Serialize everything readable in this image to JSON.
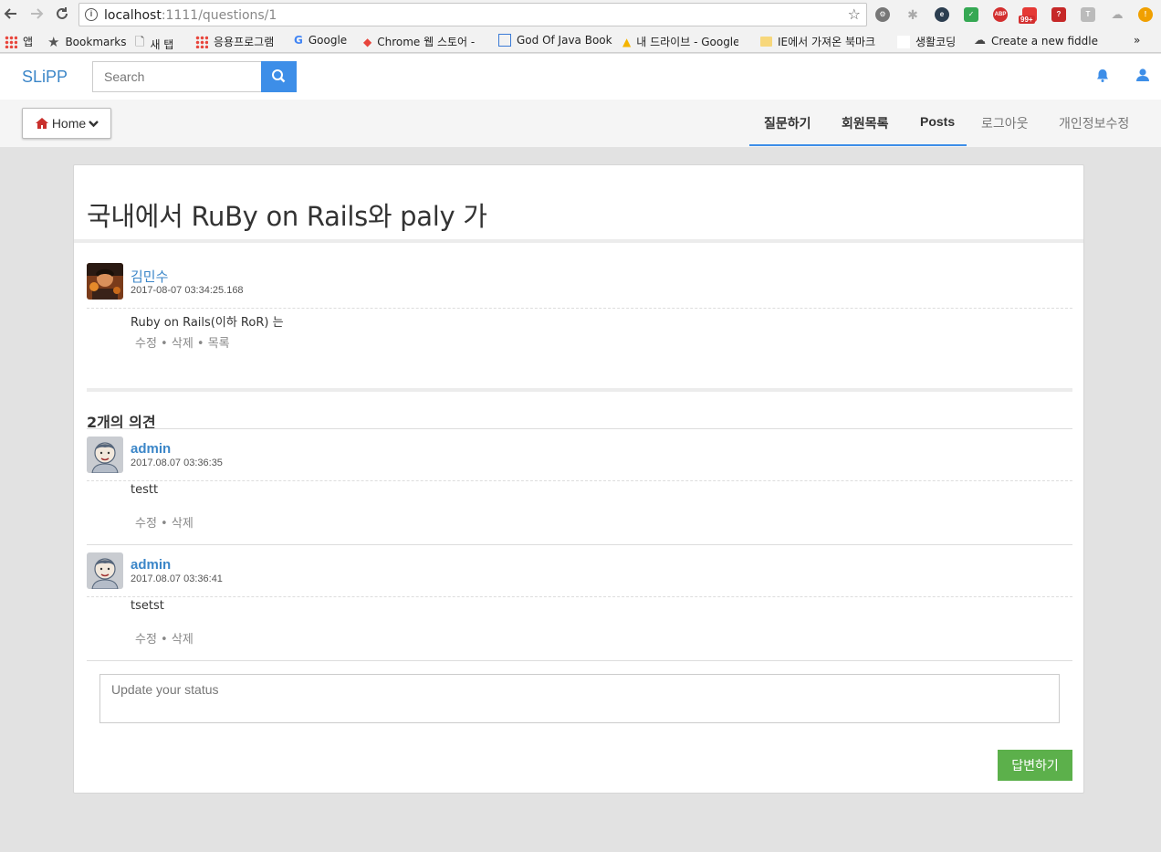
{
  "browser": {
    "url_host": "localhost",
    "url_path": ":1111/questions/1",
    "bookmarks": [
      "앱",
      "Bookmarks",
      "새 탭",
      "응용프로그램",
      "Google",
      "Chrome 웹 스토어 -",
      "God Of Java Book",
      "내 드라이브 - Google",
      "IE에서 가져온 북마크",
      "생활코딩",
      "Create a new fiddle"
    ],
    "more": "»",
    "badge": "99+",
    "abp": "ABP"
  },
  "navbar": {
    "brand": "SLiPP",
    "search_placeholder": "Search"
  },
  "subnav": {
    "home_label": "Home",
    "tabs": [
      "질문하기",
      "회원목록",
      "Posts",
      "로그아웃",
      "개인정보수정"
    ]
  },
  "question": {
    "title": "국내에서 RuBy on Rails와 paly 가",
    "author": "김민수",
    "date": "2017-08-07 03:34:25.168",
    "body": "Ruby on Rails(이하 RoR) 는",
    "actions": [
      "수정",
      "삭제",
      "목록"
    ]
  },
  "answers_count": "2개의 의견",
  "answers": [
    {
      "author": "admin",
      "date": "2017.08.07 03:36:35",
      "body": "testt",
      "actions": [
        "수정",
        "삭제"
      ]
    },
    {
      "author": "admin",
      "date": "2017.08.07 03:36:41",
      "body": "tsetst",
      "actions": [
        "수정",
        "삭제"
      ]
    }
  ],
  "form": {
    "placeholder": "Update your status",
    "submit_label": "답변하기"
  },
  "colors": {
    "brand": "#3b86c8",
    "primary": "#3d8ee8",
    "success": "#5cb04b"
  }
}
